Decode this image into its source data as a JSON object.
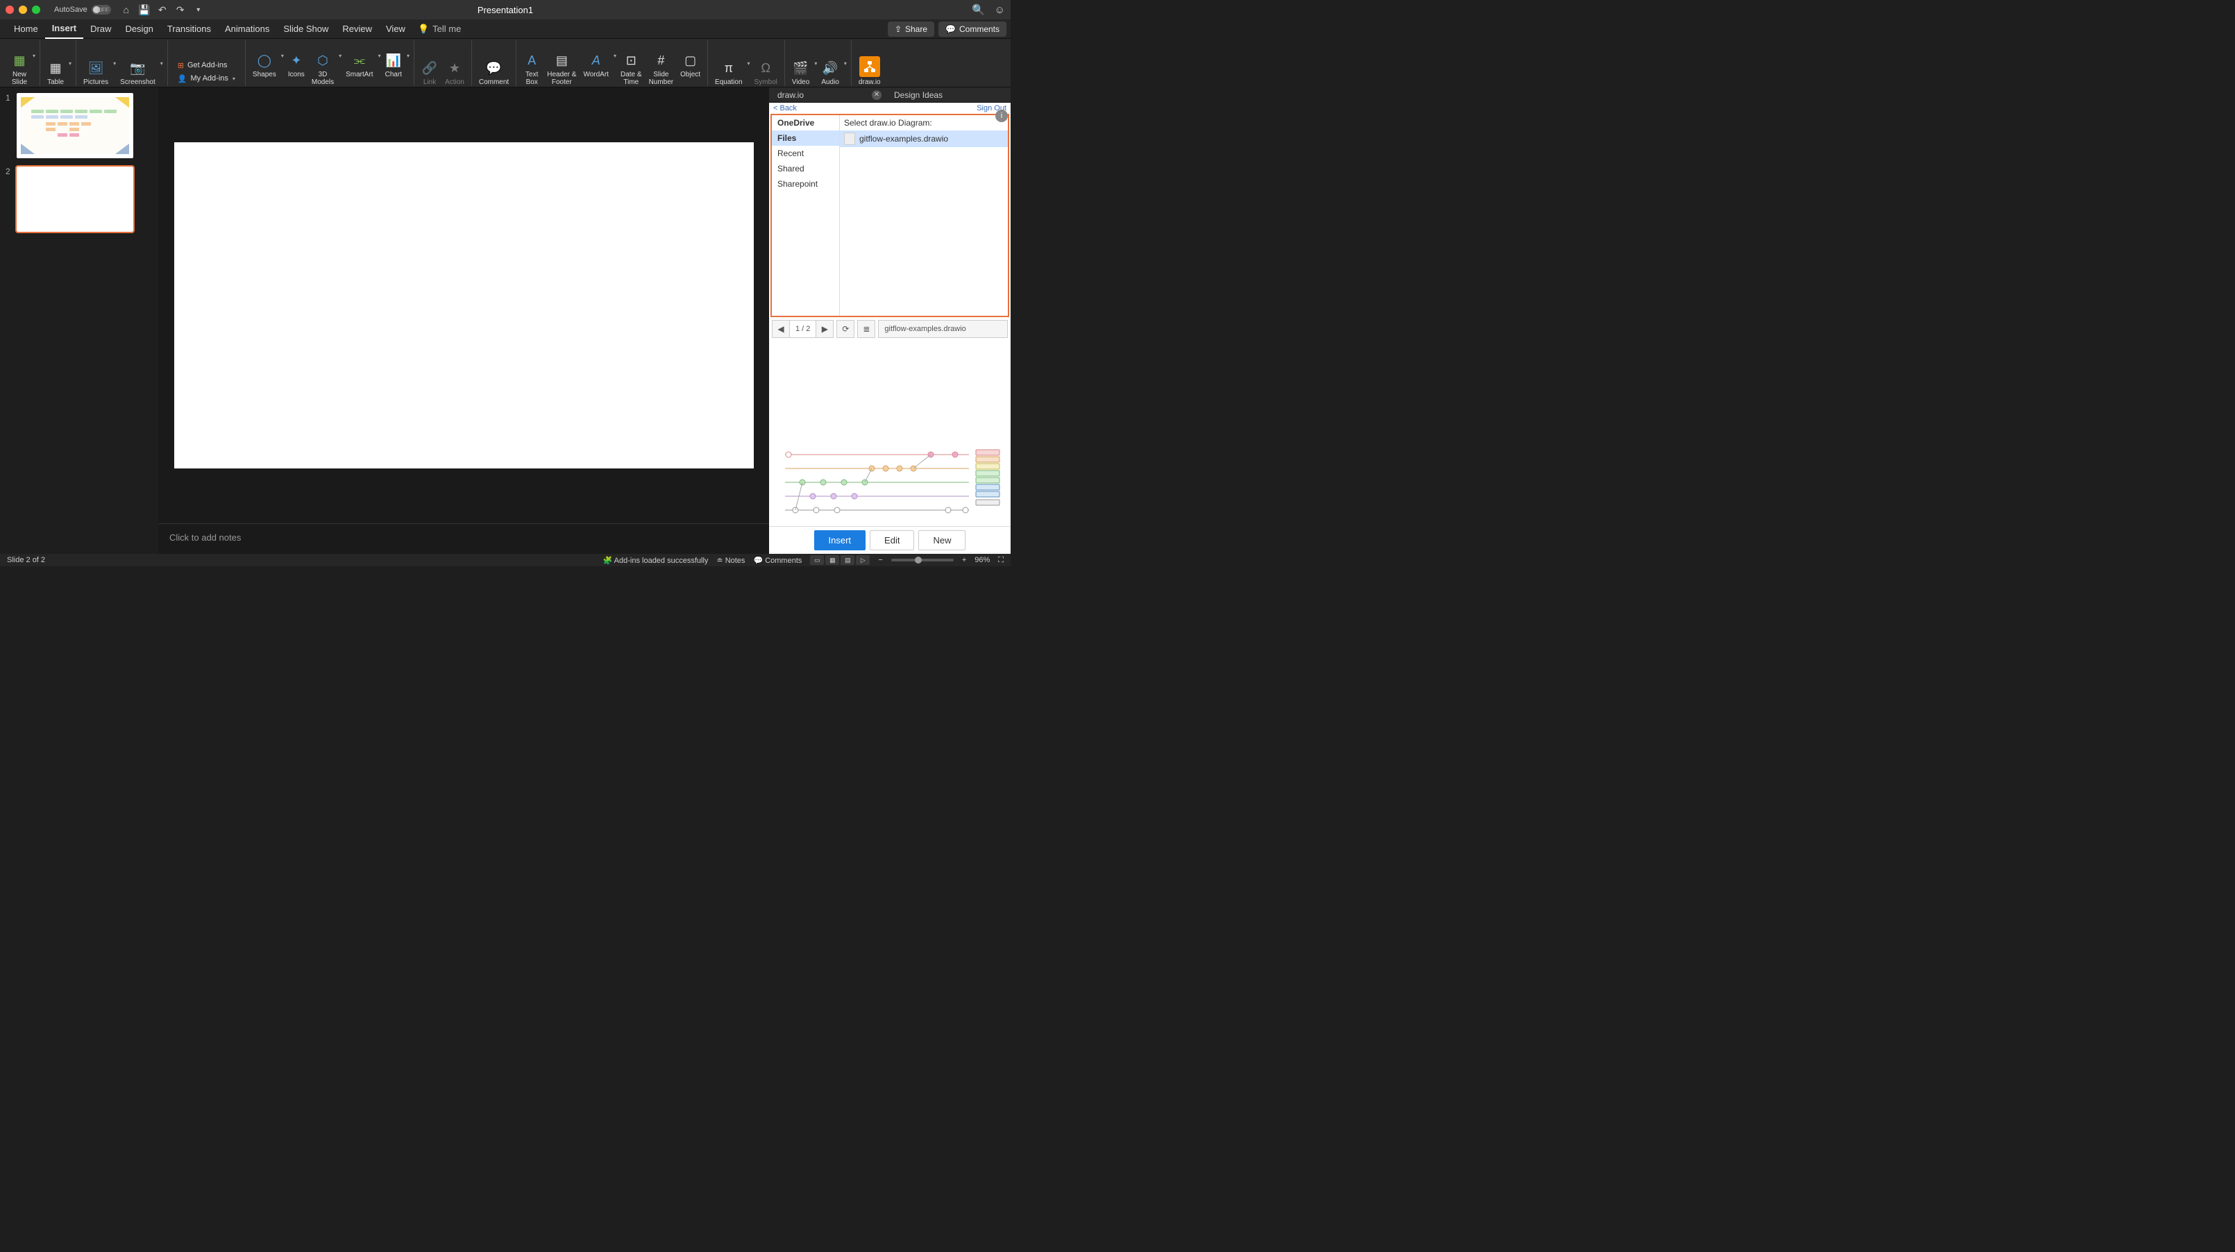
{
  "titlebar": {
    "autosave_label": "AutoSave",
    "autosave_state": "OFF",
    "title": "Presentation1"
  },
  "menu": {
    "tabs": [
      "Home",
      "Insert",
      "Draw",
      "Design",
      "Transitions",
      "Animations",
      "Slide Show",
      "Review",
      "View"
    ],
    "active": "Insert",
    "tellme": "Tell me",
    "share": "Share",
    "comments": "Comments"
  },
  "ribbon": {
    "new_slide": "New\nSlide",
    "table": "Table",
    "pictures": "Pictures",
    "screenshot": "Screenshot",
    "get_addins": "Get Add-ins",
    "my_addins": "My Add-ins",
    "shapes": "Shapes",
    "icons": "Icons",
    "models": "3D\nModels",
    "smartart": "SmartArt",
    "chart": "Chart",
    "link": "Link",
    "action": "Action",
    "comment": "Comment",
    "textbox": "Text\nBox",
    "headerfooter": "Header &\nFooter",
    "wordart": "WordArt",
    "datetime": "Date &\nTime",
    "slidenum": "Slide\nNumber",
    "object": "Object",
    "equation": "Equation",
    "symbol": "Symbol",
    "video": "Video",
    "audio": "Audio",
    "drawio": "draw.io"
  },
  "thumbs": {
    "n1": "1",
    "n2": "2"
  },
  "notes": {
    "placeholder": "Click to add notes"
  },
  "panels": {
    "drawio_tab": "draw.io",
    "design_ideas": "Design Ideas",
    "back": "< Back",
    "signout": "Sign Out",
    "onedrive": "OneDrive",
    "files": "Files",
    "recent": "Recent",
    "shared": "Shared",
    "sharepoint": "Sharepoint",
    "select_label": "Select draw.io Diagram:",
    "file1": "gitflow-examples.drawio",
    "page_indicator": "1 / 2",
    "current_file": "gitflow-examples.drawio",
    "insert": "Insert",
    "edit": "Edit",
    "new": "New"
  },
  "statusbar": {
    "slide_info": "Slide 2 of 2",
    "addins_status": "Add-ins loaded successfully",
    "notes": "Notes",
    "comments": "Comments",
    "zoom": "96%"
  }
}
